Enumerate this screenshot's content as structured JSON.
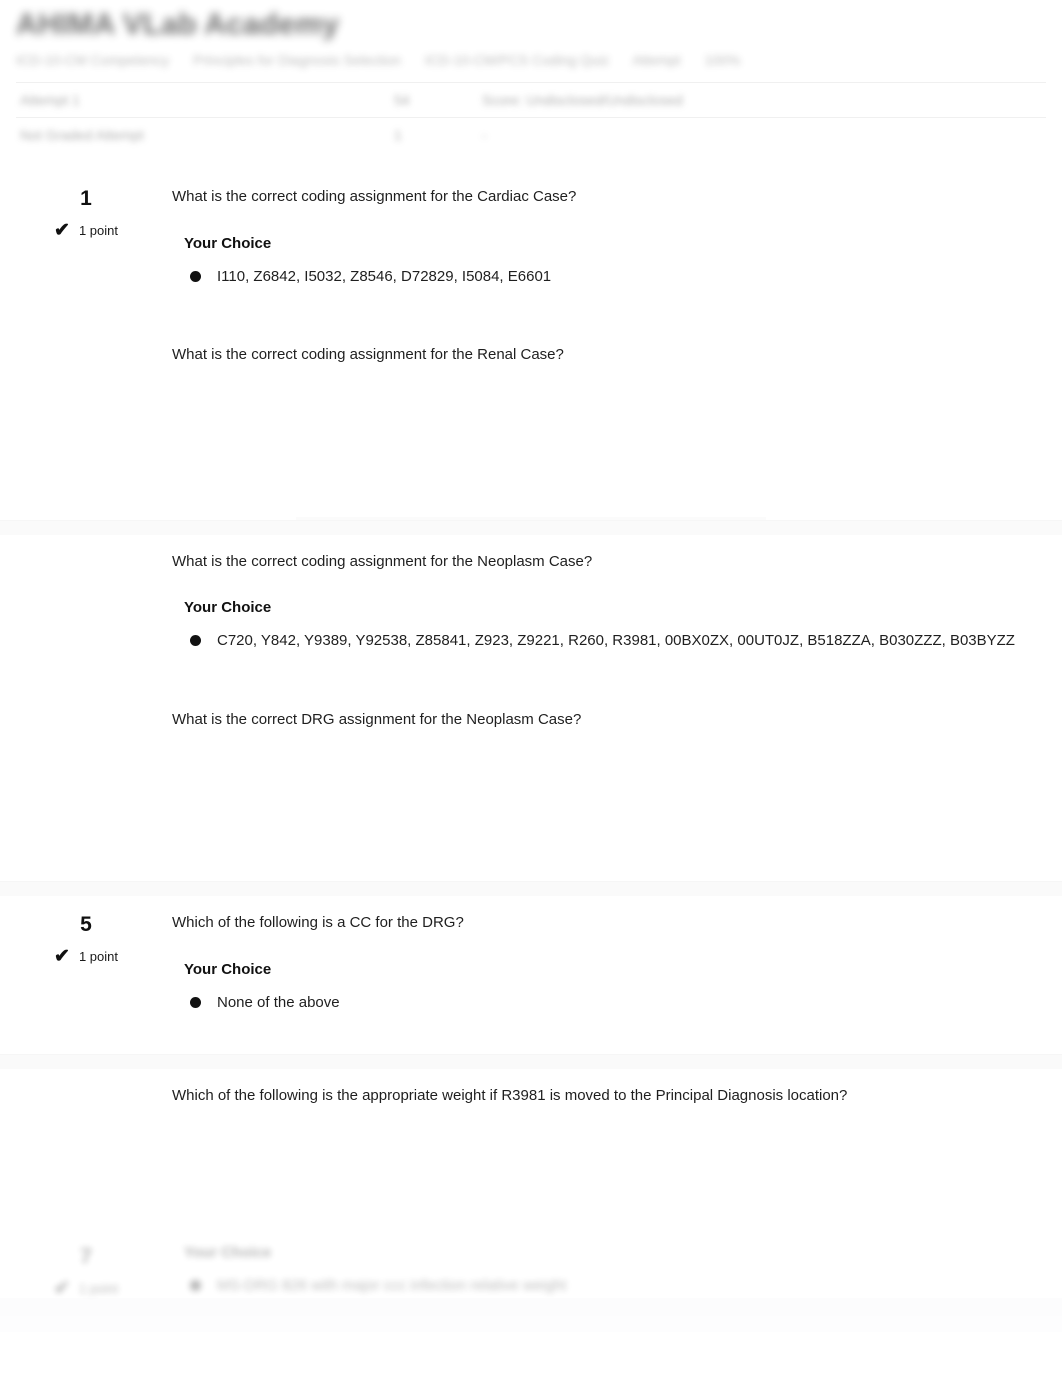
{
  "header": {
    "site_title": "AHIMA VLab Academy",
    "breadcrumb": [
      "ICD-10-CM Competency",
      "Principles for Diagnosis Selection",
      "ICD-10-CM/PCS Coding Quiz",
      "Attempt",
      "100%"
    ],
    "meta_rows": [
      {
        "label": "Attempt 1",
        "value2": "54",
        "value3": "Score: Undisclosed/Undisclosed"
      },
      {
        "label": "Not Graded Attempt",
        "value2": "1",
        "value3": "-"
      }
    ]
  },
  "quiz": {
    "questions": [
      {
        "number": "1",
        "points": "1 point",
        "check_icon": "checkmark-icon",
        "text": "What is the correct coding assignment for the Cardiac Case?",
        "choice_label": "Your Choice",
        "choice_text": "I110, Z6842, I5032, Z8546, D72829, I5084, E6601"
      },
      {
        "number": "",
        "points": "",
        "text": "What is the correct coding assignment for the Renal Case?",
        "choice_label": "",
        "choice_text": ""
      },
      {
        "number": "",
        "points": "",
        "text": "What is the correct coding assignment for the Neoplasm Case?",
        "choice_label": "Your Choice",
        "choice_text": "C720, Y842, Y9389, Y92538, Z85841, Z923, Z9221, R260, R3981, 00BX0ZX, 00UT0JZ, B518ZZA, B030ZZZ, B03BYZZ"
      },
      {
        "number": "",
        "points": "",
        "text": "What is the correct DRG assignment for the Neoplasm Case?",
        "choice_label": "",
        "choice_text": ""
      },
      {
        "number": "5",
        "points": "1 point",
        "check_icon": "checkmark-icon",
        "text": "Which of the following is a CC for the DRG?",
        "choice_label": "Your Choice",
        "choice_text": "None of the above"
      },
      {
        "number": "",
        "points": "",
        "text": "Which of the following is the appropriate weight if R3981 is moved to the Principal Diagnosis location?",
        "choice_label": "",
        "choice_text": ""
      }
    ],
    "faded_question": {
      "number": "7",
      "points": "1 point",
      "text": "",
      "choice_label": "Your Choice",
      "choice_text": "MS-DRG 826 with major ccc infection relative weight"
    }
  },
  "colors": {
    "text": "#1f1f1f",
    "muted": "#6a6a6a",
    "band": "#fbfbfc",
    "bullet": "#111111"
  }
}
